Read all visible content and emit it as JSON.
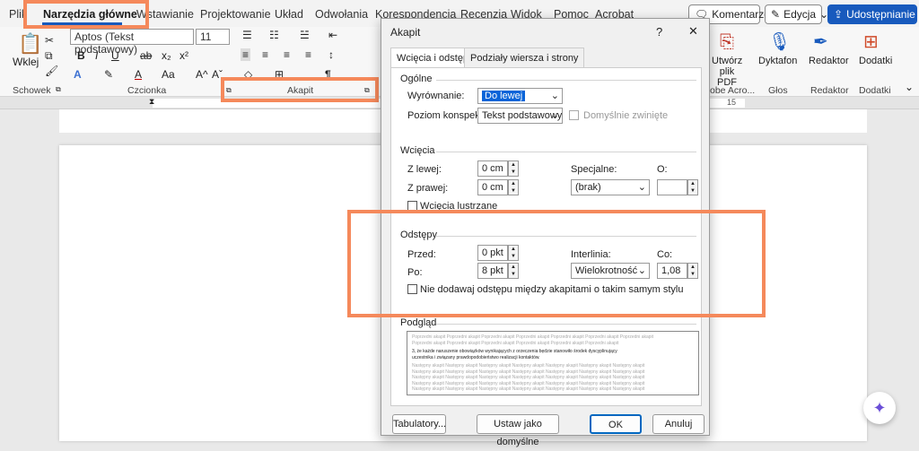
{
  "menu": {
    "tabs": [
      "Plik",
      "Narzędzia główne",
      "Wstawianie",
      "Projektowanie",
      "Układ",
      "Odwołania",
      "Korespondencja",
      "Recenzja",
      "Widok",
      "Pomoc",
      "Acrobat"
    ]
  },
  "top_buttons": {
    "comments": "Komentarze",
    "editing": "Edycja",
    "share": "Udostępnianie"
  },
  "ribbon": {
    "paste": "Wklej",
    "clipboard": "Schowek",
    "font_group": "Czcionka",
    "paragraph_group": "Akapit",
    "font_name": "Aptos (Tekst podstawowy)",
    "font_size": "11",
    "create_pdf": "Utwórz plik PDF",
    "acrobat_group": "obe Acro...",
    "dictate": "Dyktafon",
    "voice_group": "Głos",
    "editor": "Redaktor",
    "editor_group": "Redaktor",
    "addins": "Dodatki",
    "addins_group": "Dodatki"
  },
  "ruler": {
    "right_number": "15"
  },
  "dialog": {
    "title": "Akapit",
    "help": "?",
    "close": "✕",
    "tabs": [
      "Wcięcia i odstępy",
      "Podziały wiersza i strony"
    ],
    "general": {
      "heading": "Ogólne",
      "alignment_label": "Wyrównanie:",
      "alignment_value": "Do lewej",
      "outline_label": "Poziom konspektu:",
      "outline_value": "Tekst podstawowy",
      "collapsed_label": "Domyślnie zwinięte"
    },
    "indent": {
      "heading": "Wcięcia",
      "left_label": "Z lewej:",
      "left_value": "0 cm",
      "right_label": "Z prawej:",
      "right_value": "0 cm",
      "special_label": "Specjalne:",
      "special_value": "(brak)",
      "by_label": "O:",
      "by_value": "",
      "mirror_label": "Wcięcia lustrzane"
    },
    "spacing": {
      "heading": "Odstępy",
      "before_label": "Przed:",
      "before_value": "0 pkt",
      "after_label": "Po:",
      "after_value": "8 pkt",
      "line_label": "Interlinia:",
      "line_value": "Wielokrotność",
      "at_label": "Co:",
      "at_value": "1,08",
      "dont_add_label": "Nie dodawaj odstępu między akapitami o takim samym stylu"
    },
    "preview": {
      "heading": "Podgląd",
      "prev": [
        "Poprzedni akapit Poprzedni akapit Poprzedni akapit Poprzedni akapit Poprzedni akapit Poprzedni akapit Poprzedni akapit",
        "Poprzedni akapit Poprzedni akapit Poprzedni akapit Poprzedni akapit Poprzedni akapit Poprzedni akapit"
      ],
      "main": [
        "3, że każde naruszenie obowiązków wynikających z orzeczenia będzie stanowiło środek dyscyplinujący",
        "uczestnika i związany prawdopodobieństwo realizacji kontaktów."
      ],
      "next": [
        "Następny akapit Następny akapit Następny akapit Następny akapit Następny akapit Następny akapit Następny akapit",
        "Następny akapit Następny akapit Następny akapit Następny akapit Następny akapit Następny akapit Następny akapit",
        "Następny akapit Następny akapit Następny akapit Następny akapit Następny akapit Następny akapit Następny akapit",
        "Następny akapit Następny akapit Następny akapit Następny akapit Następny akapit Następny akapit Następny akapit",
        "Następny akapit Następny akapit Następny akapit Następny akapit Następny akapit Następny akapit Następny akapit"
      ]
    },
    "buttons": {
      "tabs": "Tabulatory...",
      "default": "Ustaw jako domyślne",
      "ok": "OK",
      "cancel": "Anuluj"
    }
  },
  "colors": {
    "highlight": "#f5895b",
    "accent": "#185abd"
  }
}
